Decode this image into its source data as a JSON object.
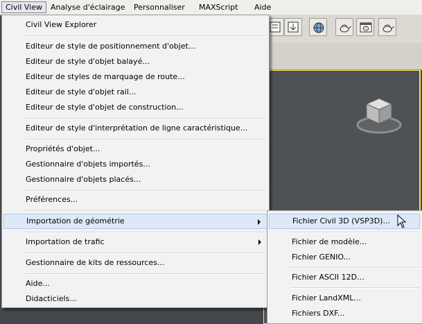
{
  "menubar": {
    "items": [
      "Civil View",
      "Analyse d'éclairage",
      "Personnaliser",
      "MAXScript",
      "Aide"
    ]
  },
  "main_menu": {
    "items": [
      "Civil View Explorer",
      "Editeur de style de positionnement d'objet...",
      "Editeur de style d'objet balayé...",
      "Editeur de styles de marquage de route...",
      "Editeur de style d'objet rail...",
      "Editeur de style d'objet de construction...",
      "Editeur de style d'interprétation de ligne caractéristique...",
      "Propriétés d'objet...",
      "Gestionnaire d'objets importés...",
      "Gestionnaire d'objets placés...",
      "Préférences...",
      "Importation de géométrie",
      "Importation de trafic",
      "Gestionnaire de kits de ressources...",
      "Aide...",
      "Didacticiels..."
    ]
  },
  "submenu": {
    "items": [
      "Fichier Civil 3D (VSP3D)...",
      "Fichier de modèle...",
      "Fichier GENIO...",
      "Fichier ASCII 12D...",
      "Fichier LandXML...",
      "Fichiers DXF..."
    ]
  },
  "colors": {
    "highlight": "#dde9f7",
    "viewport_border": "#f7e84a"
  }
}
